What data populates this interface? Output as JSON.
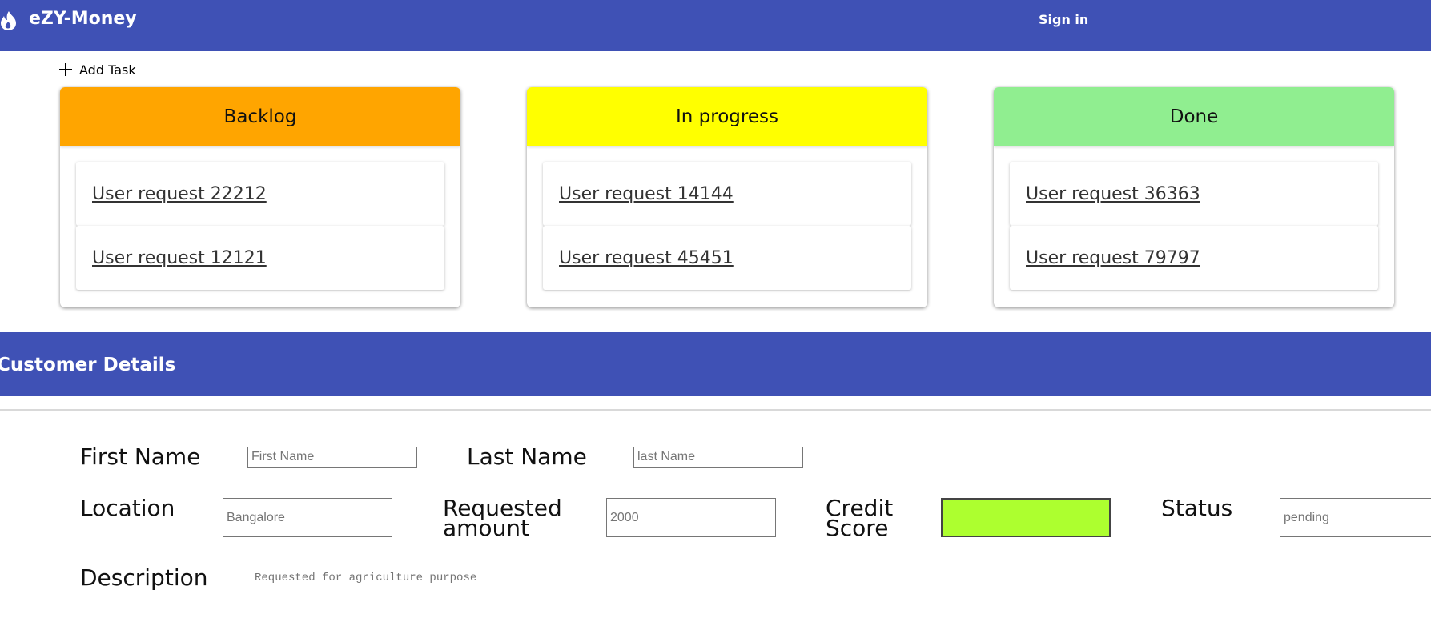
{
  "appbar": {
    "title": "eZY-Money",
    "logo_icon": "fire-icon",
    "signin_label": "Sign in",
    "color": "#3f51b5"
  },
  "add_task": {
    "label": "Add Task",
    "icon": "plus-icon"
  },
  "columns": [
    {
      "title": "Backlog",
      "color": "#ffa500",
      "cards": [
        "User request 22212",
        "User request 12121"
      ]
    },
    {
      "title": "In progress",
      "color": "#ffff00",
      "cards": [
        "User request 14144",
        "User request 45451"
      ]
    },
    {
      "title": "Done",
      "color": "#90ee90",
      "cards": [
        "User request 36363",
        "User request 79797"
      ]
    }
  ],
  "customer_details": {
    "title": "Customer Details",
    "fields": {
      "first_name": {
        "label": "First Name",
        "placeholder": "First Name"
      },
      "last_name": {
        "label": "Last Name",
        "placeholder": "last Name"
      },
      "location": {
        "label": "Location",
        "placeholder": "Bangalore"
      },
      "requested_amount": {
        "label_line1": "Requested",
        "label_line2": "amount",
        "placeholder": "2000"
      },
      "credit_score": {
        "label_line1": "Credit",
        "label_line2": "Score",
        "color": "#adff2f"
      },
      "status": {
        "label": "Status",
        "placeholder": "pending"
      },
      "description": {
        "label": "Description",
        "placeholder": "Requested for agriculture purpose"
      }
    }
  }
}
